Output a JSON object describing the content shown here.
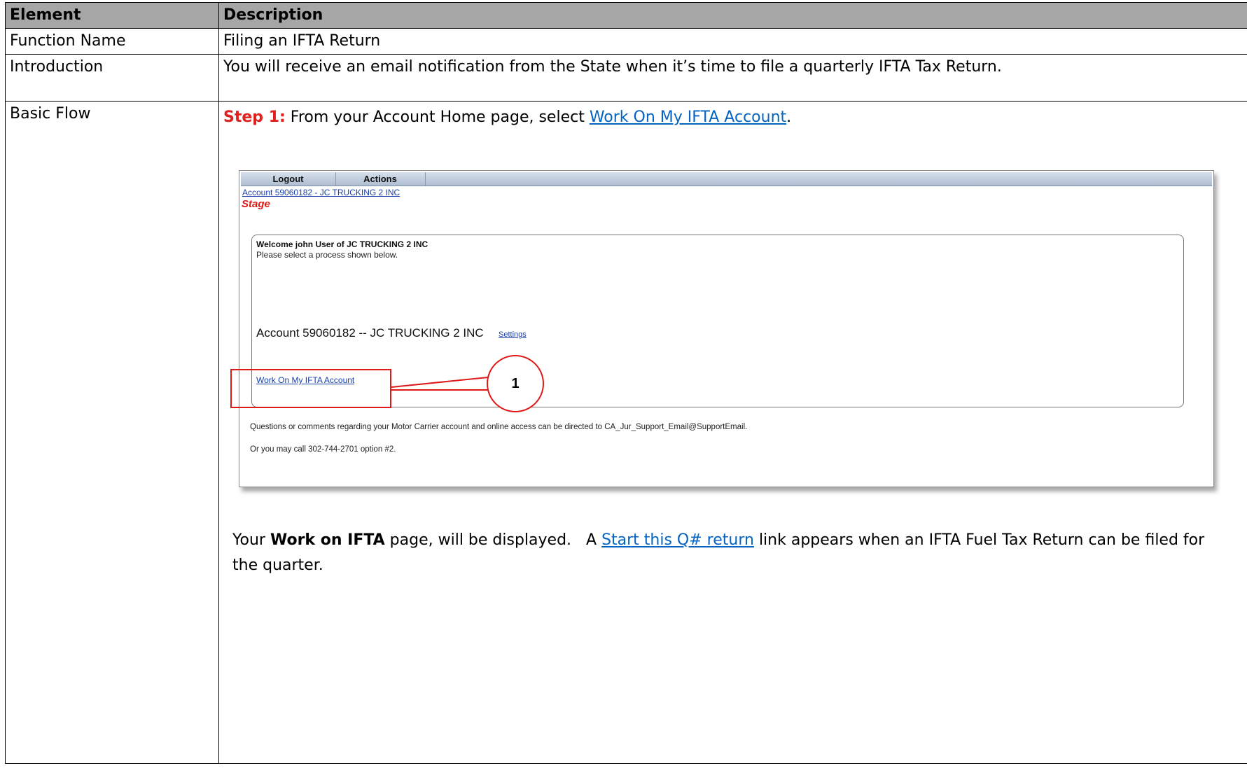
{
  "table": {
    "headers": [
      "Element",
      "Description"
    ],
    "function_name": {
      "label": "Function Name",
      "value": "Filing an IFTA Return"
    },
    "introduction": {
      "label": "Introduction",
      "value": "You will receive an email notification from the State when it’s time to file a quarterly IFTA Tax Return."
    },
    "basic_flow": {
      "label": "Basic Flow",
      "step1_label": "Step 1:",
      "step1_text": " From your Account Home page, select ",
      "step1_link": "Work On My IFTA Account",
      "step1_end": ".",
      "after_text_1": "Your ",
      "after_bold": "Work on IFTA",
      "after_text_2": " page, will be displayed.   A ",
      "after_link": "Start this Q# return",
      "after_text_3": " link appears when an IFTA Fuel Tax Return can be filed for the quarter."
    }
  },
  "screenshot": {
    "menu": [
      "Logout",
      "Actions"
    ],
    "account_link": "Account 59060182 - JC TRUCKING 2 INC",
    "stage": "Stage",
    "welcome": "Welcome john User of JC TRUCKING 2 INC",
    "instructions": "Please select a process shown below.",
    "account_title": "Account 59060182 -- JC TRUCKING 2 INC",
    "settings_link": "Settings",
    "ifta_link": "Work On My IFTA Account",
    "footer_line1": "Questions or comments regarding your Motor Carrier account and online access can be directed to CA_Jur_Support_Email@SupportEmail.",
    "footer_line2": "Or you may call 302-744-2701 option #2."
  },
  "callout": {
    "number": "1",
    "color": "#e01818"
  }
}
